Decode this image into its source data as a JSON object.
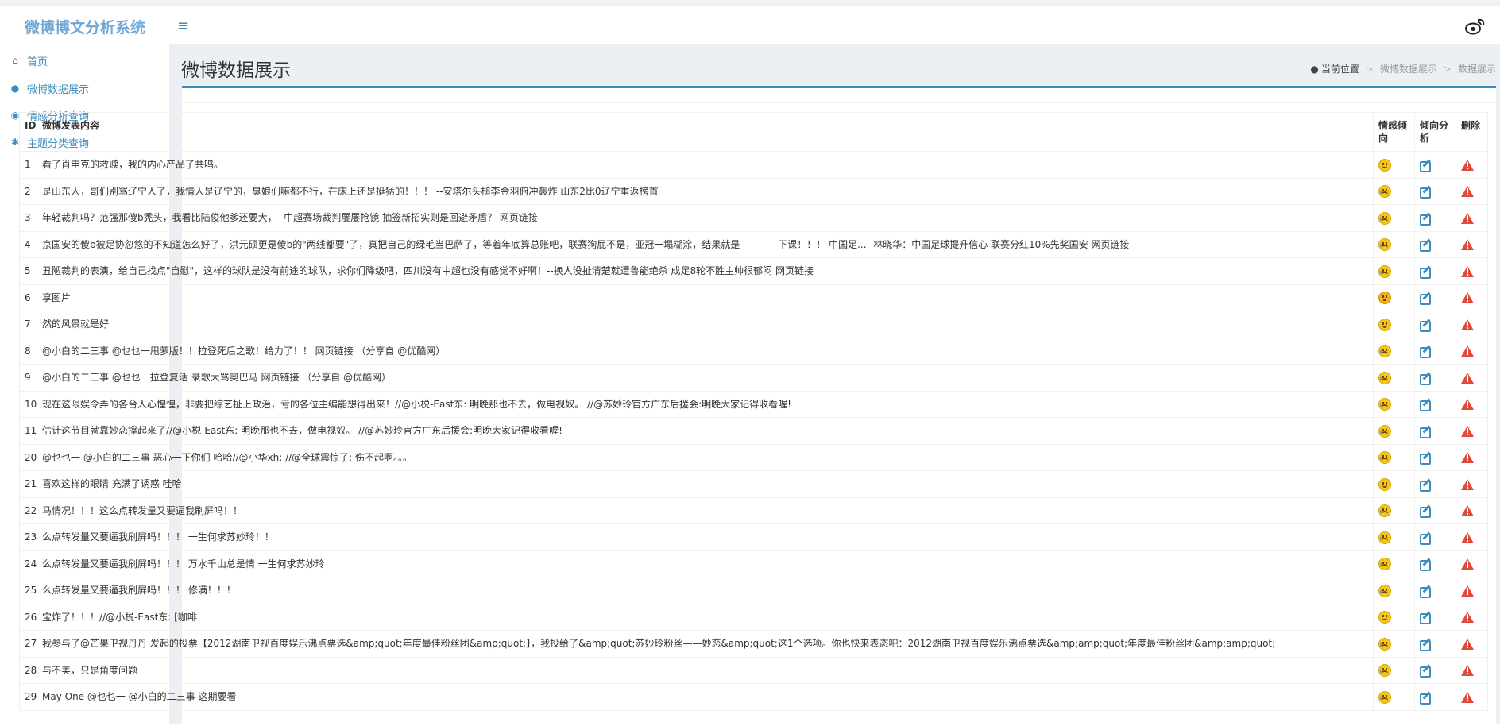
{
  "app": {
    "title": "微博博文分析系统"
  },
  "sidebar": {
    "items": [
      {
        "icon": "home-icon",
        "label": "首页"
      },
      {
        "icon": "user-icon",
        "label": "微博数据展示"
      },
      {
        "icon": "chevron-circle-icon",
        "label": "情感分析查询"
      },
      {
        "icon": "bug-icon",
        "label": "主题分类查询"
      }
    ]
  },
  "page": {
    "title": "微博数据展示",
    "breadcrumb": {
      "icon": "dashboard-icon",
      "home": "当前位置",
      "parent": "微博数据展示",
      "current": "数据展示",
      "sep": ">"
    }
  },
  "table": {
    "headers": {
      "id": "ID",
      "content": "微博发表内容",
      "sentiment": "情感倾向",
      "analysis": "倾向分析",
      "delete": "删除"
    },
    "rows": [
      {
        "id": "1",
        "content": "看了肖申克的救赎，我的内心产品了共鸣。",
        "emotion": "happy"
      },
      {
        "id": "2",
        "content": "是山东人，哥们别骂辽宁人了，我情人是辽宁的，臭娘们嘛都不行，在床上还是挺猛的！！！ --安塔尔头槌李金羽俯冲轰炸 山东2比0辽宁重返榜首",
        "emotion": "sad"
      },
      {
        "id": "3",
        "content": "年轻裁判吗？范强那傻b秃头，我看比陆俊他爹还要大，--中超赛场裁判屡屡抢镜 抽签新招实则是回避矛盾？ 网页链接",
        "emotion": "sad"
      },
      {
        "id": "4",
        "content": "京国安的傻b被足协忽悠的不知道怎么好了，洪元硕更是傻b的\"两线都要\"了，真把自己的绿毛当巴萨了，等着年底算总账吧，联赛狗屁不是，亚冠一塌糊涂，结果就是————下课！！！ 中国足...--林晓华：中国足球提升信心 联赛分红10%先奖国安 网页链接",
        "emotion": "sad"
      },
      {
        "id": "5",
        "content": "丑陋裁判的表演，给自己找点\"自慰\"，这样的球队是没有前途的球队，求你们降级吧，四川没有中超也没有感觉不好啊！--换人没扯清楚就遭鲁能绝杀 成足8轮不胜主帅很郁闷 网页链接",
        "emotion": "sad"
      },
      {
        "id": "6",
        "content": "享图片",
        "emotion": "neutral"
      },
      {
        "id": "7",
        "content": "然的风景就是好",
        "emotion": "happy"
      },
      {
        "id": "8",
        "content": "@小白的二三事 @乜乜一甩萝版！！拉登死后之歌！给力了！！ 网页链接 （分享自 @优酷网）",
        "emotion": "sad"
      },
      {
        "id": "9",
        "content": "@小白的二三事 @乜乜一拉登复活 录歌大骂奥巴马 网页链接 （分享自 @优酷网）",
        "emotion": "sad"
      },
      {
        "id": "10",
        "content": "现在这限娱令弄的各台人心惶惶，非要把综艺扯上政治，亏的各位主编能想得出来！//@小棁-East东: 明晚那也不去，做电视奴。 //@苏妙玲官方广东后援会:明晚大家记得收看喔!",
        "emotion": "sad"
      },
      {
        "id": "11",
        "content": "估计这节目就靠妙恋撑起来了//@小棁-East东: 明晚那也不去，做电视奴。 //@苏妙玲官方广东后援会:明晚大家记得收看喔!",
        "emotion": "sad"
      },
      {
        "id": "20",
        "content": "@乜乜一 @小白的二三事 恶心一下你们 哈哈//@小华xh: //@全球震惊了: 伤不起啊。。。",
        "emotion": "sad"
      },
      {
        "id": "21",
        "content": "喜欢这样的眼睛 充满了诱惑 哇哈",
        "emotion": "happy"
      },
      {
        "id": "22",
        "content": "马情况！！！这么点转发量又要逼我刷屏吗！！",
        "emotion": "sad"
      },
      {
        "id": "23",
        "content": "么点转发量又要逼我刷屏吗！！！ 一生何求苏妙玲！！",
        "emotion": "sad"
      },
      {
        "id": "24",
        "content": "么点转发量又要逼我刷屏吗！！！ 万水千山总是情 一生何求苏妙玲",
        "emotion": "sad"
      },
      {
        "id": "25",
        "content": "么点转发量又要逼我刷屏吗！！！ 修满！！！",
        "emotion": "sad"
      },
      {
        "id": "26",
        "content": "宝炸了！！！//@小棁-East东: [咖啡",
        "emotion": "happy"
      },
      {
        "id": "27",
        "content": "我参与了@芒果卫视丹丹 发起的投票【2012湖南卫视百度娱乐沸点票选&amp;quot;年度最佳粉丝团&amp;quot;】，我投给了&amp;quot;苏妙玲粉丝——妙恋&amp;quot;这1个选项。你也快来表态吧：2012湖南卫视百度娱乐沸点票选&amp;amp;quot;年度最佳粉丝团&amp;amp;quot;",
        "emotion": "sad"
      },
      {
        "id": "28",
        "content": "与不美，只是角度问题",
        "emotion": "sad"
      },
      {
        "id": "29",
        "content": "May  One @乜乜一 @小白的二三事 这期要看",
        "emotion": "sad"
      }
    ]
  }
}
